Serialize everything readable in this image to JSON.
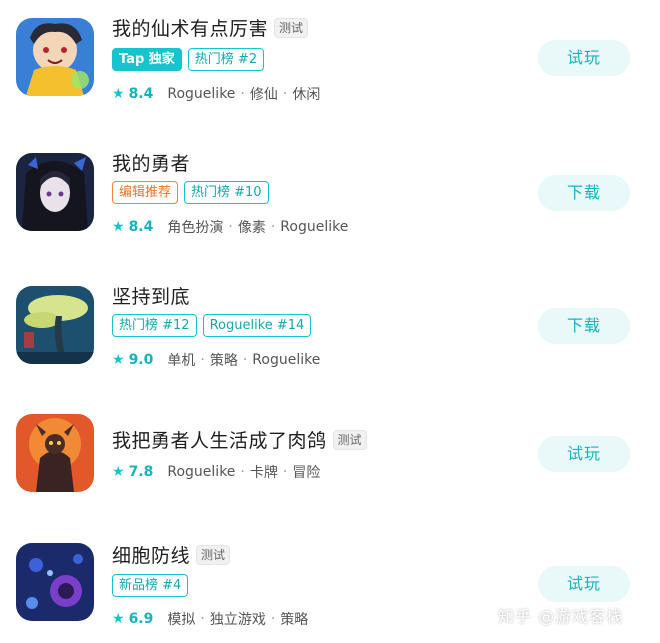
{
  "games": [
    {
      "title": "我的仙术有点厉害",
      "test_badge": "测试",
      "tags": [
        {
          "label": "Tap 独家",
          "style": "tap"
        },
        {
          "label": "热门榜 #2",
          "style": "normal"
        }
      ],
      "rating": "8.4",
      "genres": [
        "Roguelike",
        "修仙",
        "休闲"
      ],
      "action": "试玩",
      "icon": "xianshu-game-icon"
    },
    {
      "title": "我的勇者",
      "test_badge": "",
      "tags": [
        {
          "label": "编辑推荐",
          "style": "editor"
        },
        {
          "label": "热门榜 #10",
          "style": "normal"
        }
      ],
      "rating": "8.4",
      "genres": [
        "角色扮演",
        "像素",
        "Roguelike"
      ],
      "action": "下载",
      "icon": "yongzhe-game-icon"
    },
    {
      "title": "坚持到底",
      "test_badge": "",
      "tags": [
        {
          "label": "热门榜 #12",
          "style": "normal"
        },
        {
          "label": "Roguelike #14",
          "style": "normal"
        }
      ],
      "rating": "9.0",
      "genres": [
        "单机",
        "策略",
        "Roguelike"
      ],
      "action": "下载",
      "icon": "jianchi-game-icon"
    },
    {
      "title": "我把勇者人生活成了肉鸽",
      "test_badge": "测试",
      "tags": [],
      "rating": "7.8",
      "genres": [
        "Roguelike",
        "卡牌",
        "冒险"
      ],
      "action": "试玩",
      "icon": "rouge-game-icon"
    },
    {
      "title": "细胞防线",
      "test_badge": "测试",
      "tags": [
        {
          "label": "新品榜 #4",
          "style": "normal"
        }
      ],
      "rating": "6.9",
      "genres": [
        "模拟",
        "独立游戏",
        "策略"
      ],
      "action": "试玩",
      "icon": "cell-game-icon"
    }
  ],
  "watermark": "知乎 @游戏客栈",
  "colors": {
    "accent": "#15c5ce",
    "button_bg": "#e9f8f9",
    "editor_tag": "#f0843c"
  }
}
